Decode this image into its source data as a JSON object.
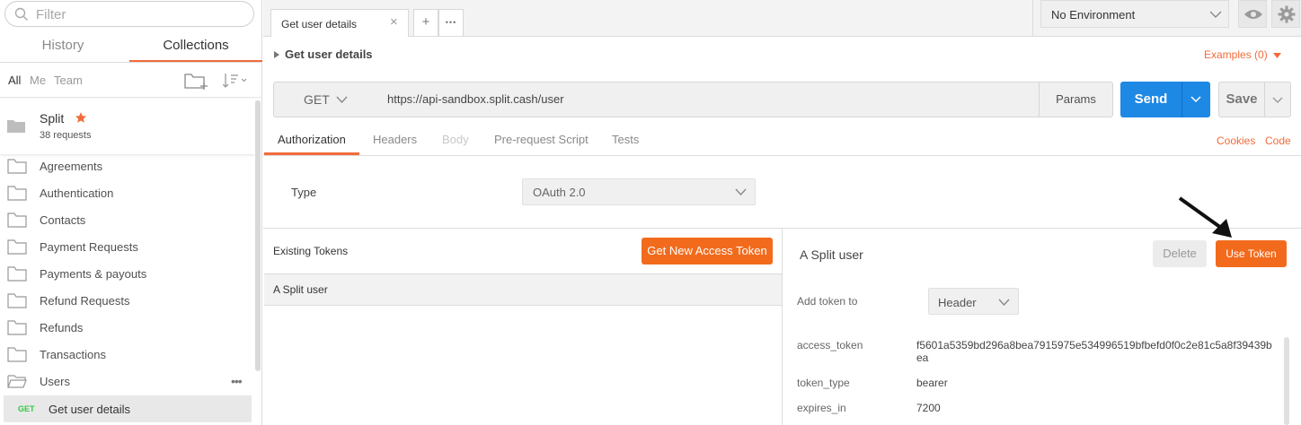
{
  "sidebar": {
    "search_placeholder": "Filter",
    "tabs": {
      "history": "History",
      "collections": "Collections"
    },
    "filters": {
      "all": "All",
      "me": "Me",
      "team": "Team"
    },
    "collection": {
      "name": "Split",
      "count": "38 requests"
    },
    "folders": [
      "Agreements",
      "Authentication",
      "Contacts",
      "Payment Requests",
      "Payments & payouts",
      "Refund Requests",
      "Refunds",
      "Transactions",
      "Users"
    ],
    "request": {
      "method": "GET",
      "name": "Get user details"
    }
  },
  "tabbar": {
    "tab_label": "Get user details",
    "add_label": "+",
    "more_label": "•••",
    "environment": "No Environment"
  },
  "request": {
    "title": "Get user details",
    "examples": "Examples (0)",
    "method": "GET",
    "url": "https://api-sandbox.split.cash/user",
    "params_label": "Params",
    "send_label": "Send",
    "save_label": "Save"
  },
  "subtabs": {
    "items": [
      "Authorization",
      "Headers",
      "Body",
      "Pre-request Script",
      "Tests"
    ],
    "cookies": "Cookies",
    "code": "Code"
  },
  "auth": {
    "type_label": "Type",
    "type_value": "OAuth 2.0",
    "existing_tokens_label": "Existing Tokens",
    "get_token_label": "Get New Access Token",
    "token_list": [
      "A Split user"
    ]
  },
  "token_detail": {
    "name": "A Split user",
    "delete_label": "Delete",
    "use_label": "Use Token",
    "add_to_label": "Add token to",
    "add_to_value": "Header",
    "fields": [
      {
        "key": "access_token",
        "value": "f5601a5359bd296a8bea7915975e534996519bfbefd0f0c2e81c5a8f39439bea"
      },
      {
        "key": "token_type",
        "value": "bearer"
      },
      {
        "key": "expires_in",
        "value": "7200"
      }
    ]
  },
  "colors": {
    "accent": "#f26b3a",
    "send": "#1e88e5",
    "get_method": "#2ecc40"
  }
}
